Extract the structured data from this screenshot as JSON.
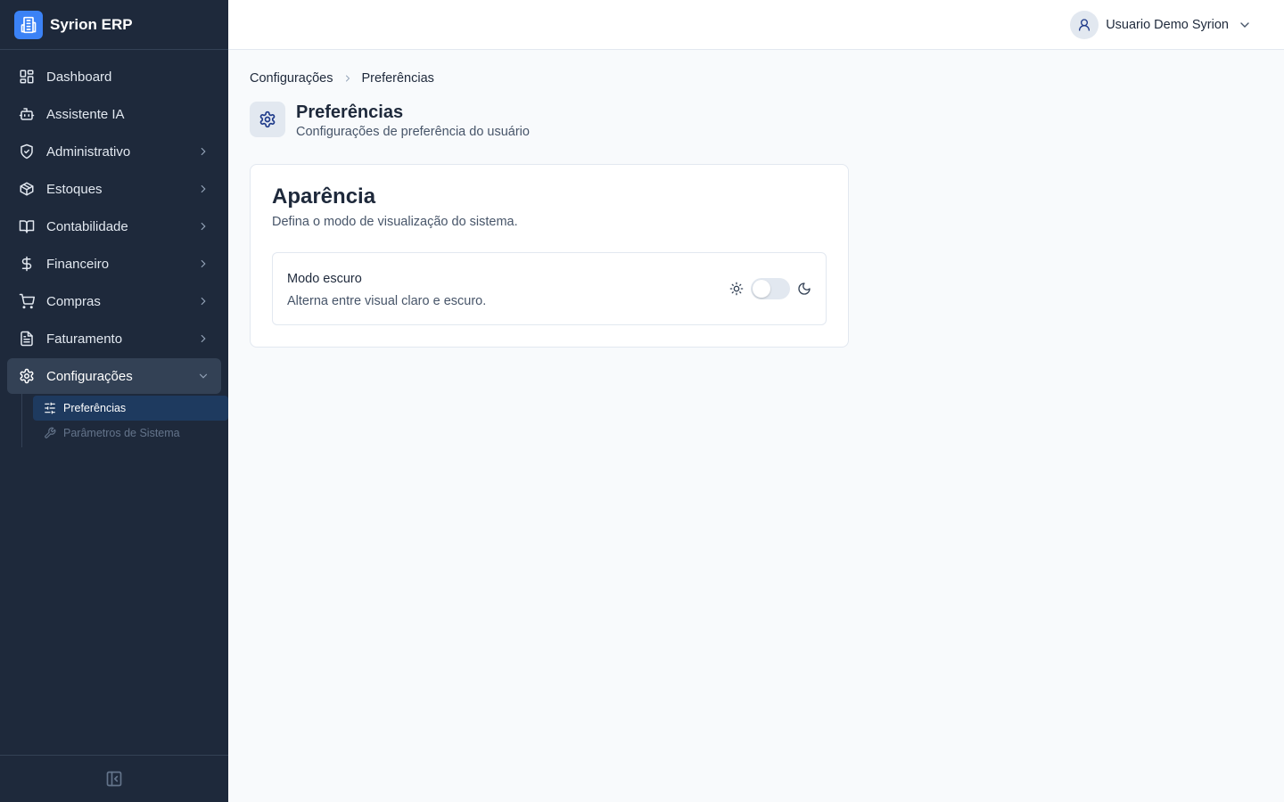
{
  "brand": {
    "name": "Syrion ERP",
    "icon": "building-icon",
    "color": "#3b82f6"
  },
  "sidebar": {
    "items": [
      {
        "label": "Dashboard",
        "icon": "layout-dashboard-icon"
      },
      {
        "label": "Assistente IA",
        "icon": "bot-icon"
      },
      {
        "label": "Administrativo",
        "icon": "shield-icon",
        "expandable": true
      },
      {
        "label": "Estoques",
        "icon": "package-icon",
        "expandable": true
      },
      {
        "label": "Contabilidade",
        "icon": "book-open-icon",
        "expandable": true
      },
      {
        "label": "Financeiro",
        "icon": "dollar-sign-icon",
        "expandable": true
      },
      {
        "label": "Compras",
        "icon": "shopping-cart-icon",
        "expandable": true
      },
      {
        "label": "Faturamento",
        "icon": "file-text-icon",
        "expandable": true
      },
      {
        "label": "Configurações",
        "icon": "gear-icon",
        "expandable": true,
        "expanded": true,
        "active": true
      }
    ],
    "subitems": [
      {
        "label": "Preferências",
        "icon": "sliders-icon",
        "active": true
      },
      {
        "label": "Parâmetros de Sistema",
        "icon": "wrench-icon",
        "active": false
      }
    ],
    "footer_icon": "panel-collapse-icon"
  },
  "topbar": {
    "user_name": "Usuario Demo Syrion",
    "avatar_icon": "user-icon"
  },
  "breadcrumb": {
    "parent": "Configurações",
    "current": "Preferências"
  },
  "page": {
    "title": "Preferências",
    "subtitle": "Configurações de preferência do usuário",
    "icon": "gear-icon"
  },
  "appearance": {
    "title": "Aparência",
    "description": "Defina o modo de visualização do sistema.",
    "dark_mode": {
      "label": "Modo escuro",
      "description": "Alterna entre visual claro e escuro.",
      "enabled": false
    }
  },
  "colors": {
    "sidebar_bg": "#1e293b",
    "active_sub_bg": "#1e3a5f",
    "page_bg": "#f8fafc"
  }
}
